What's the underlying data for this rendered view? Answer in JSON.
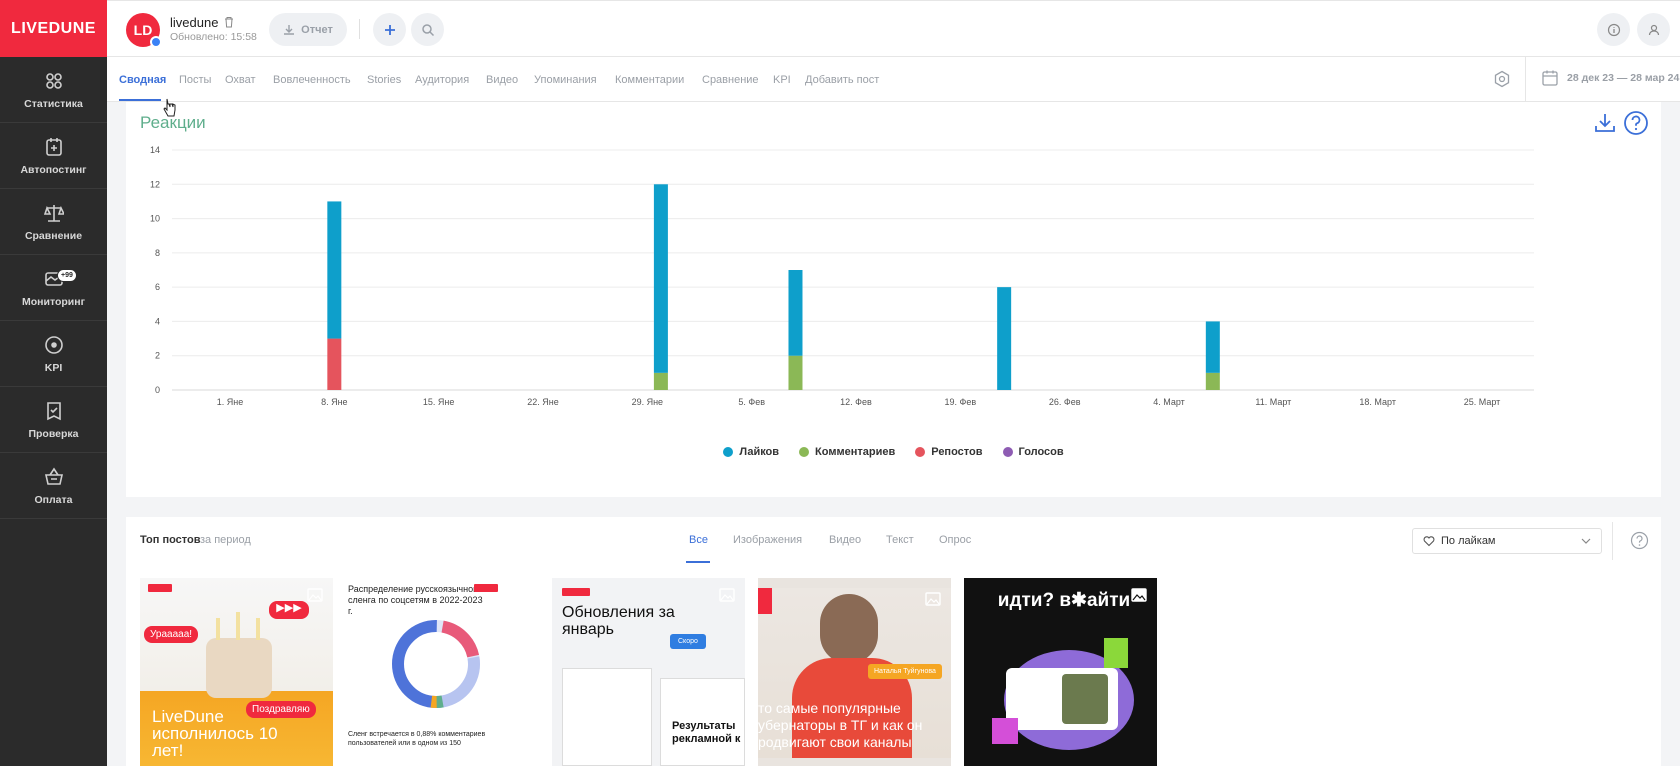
{
  "sidebar": {
    "logo": "LIVEDUNE",
    "items": [
      {
        "label": "Статистика",
        "icon": "stats-icon"
      },
      {
        "label": "Автопостинг",
        "icon": "autopost-icon"
      },
      {
        "label": "Сравнение",
        "icon": "compare-icon"
      },
      {
        "label": "Мониторинг",
        "icon": "monitoring-icon",
        "badge": "+99"
      },
      {
        "label": "KPI",
        "icon": "kpi-icon"
      },
      {
        "label": "Проверка",
        "icon": "check-icon"
      },
      {
        "label": "Оплата",
        "icon": "payment-icon"
      }
    ]
  },
  "header": {
    "avatar_initials": "LD",
    "account_name": "livedune",
    "updated": "Обновлено: 15:58",
    "report_label": "Отчет"
  },
  "tabs": [
    "Сводная",
    "Посты",
    "Охват",
    "Вовлеченность",
    "Stories",
    "Аудитория",
    "Видео",
    "Упоминания",
    "Комментарии",
    "Сравнение",
    "KPI",
    "Добавить пост"
  ],
  "date_range": "28 дек 23 — 28 мар 24",
  "chart": {
    "title": "Реакции"
  },
  "chart_data": {
    "type": "bar",
    "stacked": true,
    "ylim": [
      0,
      14
    ],
    "yticks": [
      0,
      2,
      4,
      6,
      8,
      10,
      12,
      14
    ],
    "xticks": [
      "1. Яне",
      "8. Яне",
      "15. Яне",
      "22. Яне",
      "29. Яне",
      "5. Фев",
      "12. Фев",
      "19. Фев",
      "26. Фев",
      "4. Март",
      "11. Март",
      "18. Март",
      "25. Март"
    ],
    "bars": [
      {
        "x_index": 1.0,
        "segments": {
          "Лайков": 8,
          "Комментариев": 0,
          "Репостов": 3,
          "Голосов": 0
        }
      },
      {
        "x_index": 4.13,
        "segments": {
          "Лайков": 11,
          "Комментариев": 1,
          "Репостов": 0,
          "Голосов": 0
        }
      },
      {
        "x_index": 5.42,
        "segments": {
          "Лайков": 5,
          "Комментариев": 2,
          "Репостов": 0,
          "Голосов": 0
        }
      },
      {
        "x_index": 7.42,
        "segments": {
          "Лайков": 6,
          "Комментариев": 0,
          "Репостов": 0,
          "Голосов": 0
        }
      },
      {
        "x_index": 9.42,
        "segments": {
          "Лайков": 3,
          "Комментариев": 1,
          "Репостов": 0,
          "Голосов": 0
        }
      }
    ],
    "series": [
      {
        "name": "Лайков",
        "color": "#0e9fcb"
      },
      {
        "name": "Комментариев",
        "color": "#8bb856"
      },
      {
        "name": "Репостов",
        "color": "#e5545d"
      },
      {
        "name": "Голосов",
        "color": "#8e5cb3"
      }
    ],
    "grid": true,
    "legend": "bottom-center"
  },
  "top_posts": {
    "title": "Топ постов",
    "subtitle": "за период",
    "tabs": [
      "Все",
      "Изображения",
      "Видео",
      "Текст",
      "Опрос"
    ],
    "sort_label": "По лайкам",
    "posts": [
      {
        "badge": "Урааааа!",
        "badge2": "Поздравляю",
        "caption": "LiveDune исполнилось 10 лет!"
      },
      {
        "title": "Распределение русскоязычного сленга по соцсетям в 2022-2023 г.",
        "caption": "Сленг встречается в 0,88% комментариев пользователей или в одном из 150"
      },
      {
        "title": "Обновления за январь",
        "button": "Скоро",
        "caption": "Результаты рекламной к"
      },
      {
        "name_tag": "Наталья Туйгунова",
        "caption": "то самые популярные убернаторы в ТГ и как он родвигают свои каналы"
      },
      {
        "title": "идти? в✱айти"
      }
    ]
  },
  "colors": {
    "brand": "#f0293e",
    "accent": "#3b6fd8",
    "sidebar_bg": "#2b2b2b"
  }
}
